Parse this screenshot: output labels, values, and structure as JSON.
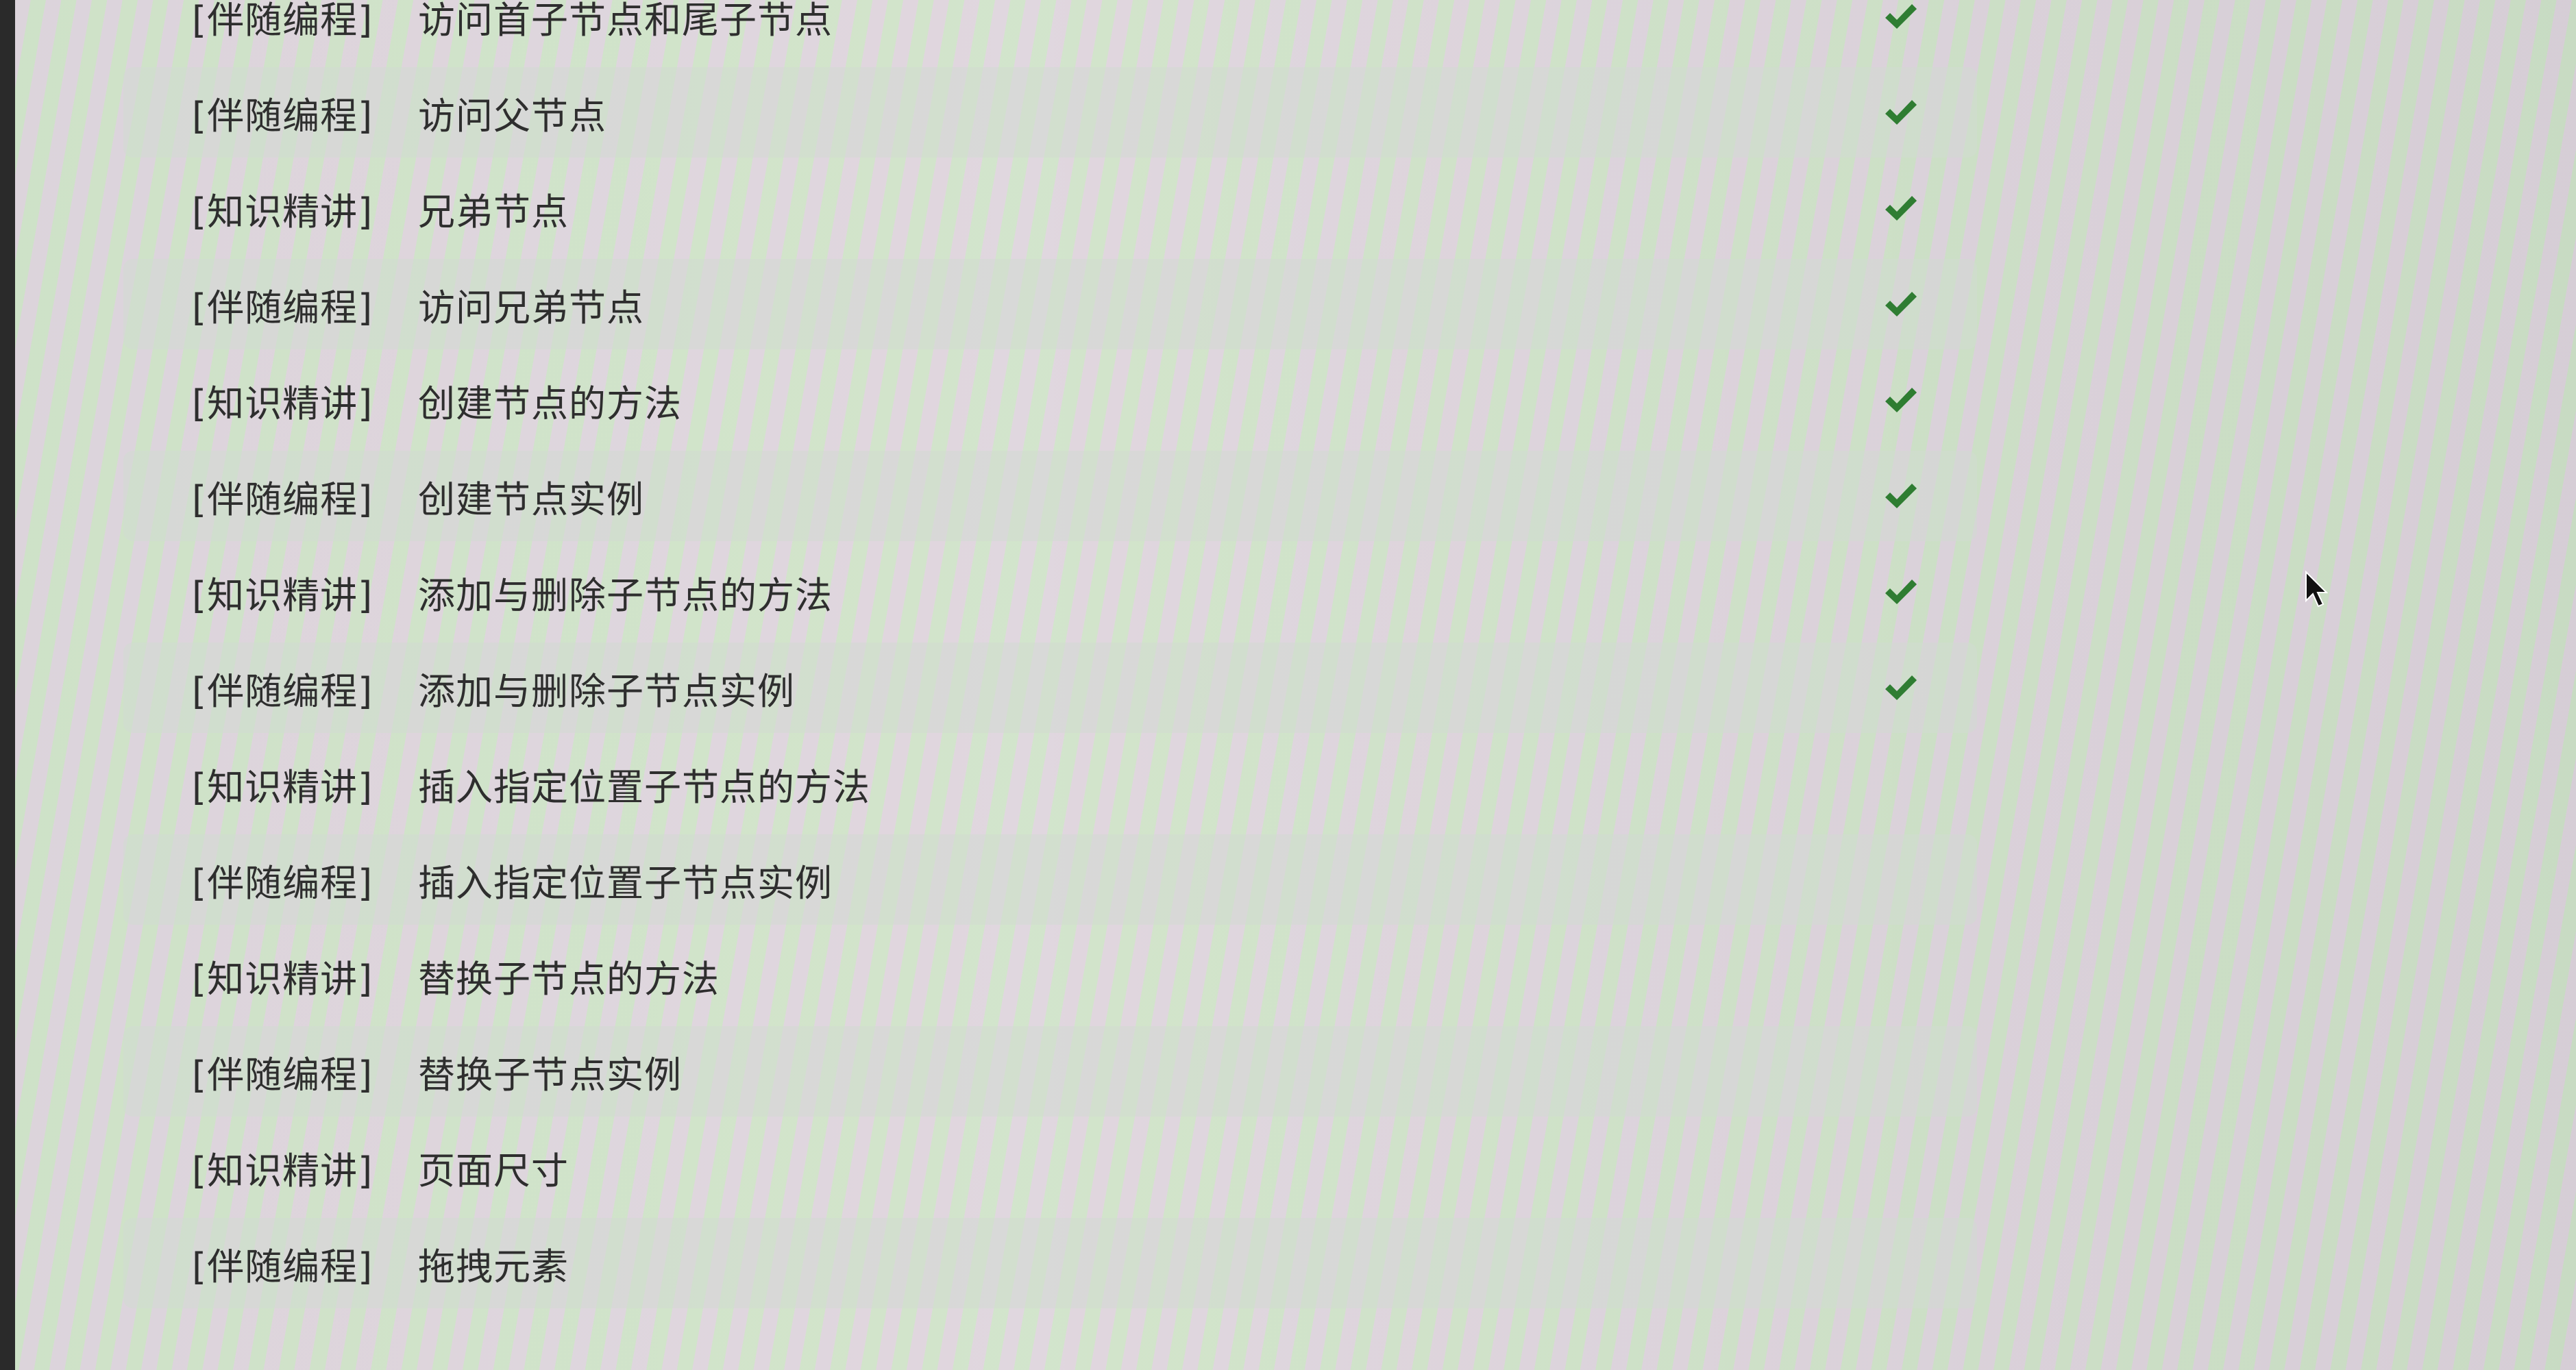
{
  "course": {
    "lessons": [
      {
        "tag": "[伴随编程]",
        "title": "访问首子节点和尾子节点",
        "completed": true
      },
      {
        "tag": "[伴随编程]",
        "title": "访问父节点",
        "completed": true
      },
      {
        "tag": "[知识精讲]",
        "title": "兄弟节点",
        "completed": true
      },
      {
        "tag": "[伴随编程]",
        "title": "访问兄弟节点",
        "completed": true
      },
      {
        "tag": "[知识精讲]",
        "title": "创建节点的方法",
        "completed": true
      },
      {
        "tag": "[伴随编程]",
        "title": "创建节点实例",
        "completed": true
      },
      {
        "tag": "[知识精讲]",
        "title": "添加与删除子节点的方法",
        "completed": true
      },
      {
        "tag": "[伴随编程]",
        "title": "添加与删除子节点实例",
        "completed": true
      },
      {
        "tag": "[知识精讲]",
        "title": "插入指定位置子节点的方法",
        "completed": false
      },
      {
        "tag": "[伴随编程]",
        "title": "插入指定位置子节点实例",
        "completed": false
      },
      {
        "tag": "[知识精讲]",
        "title": "替换子节点的方法",
        "completed": false
      },
      {
        "tag": "[伴随编程]",
        "title": "替换子节点实例",
        "completed": false
      },
      {
        "tag": "[知识精讲]",
        "title": "页面尺寸",
        "completed": false
      },
      {
        "tag": "[伴随编程]",
        "title": "拖拽元素",
        "completed": false
      }
    ]
  },
  "colors": {
    "check": "#2f7d32",
    "text": "#2e2e2e"
  },
  "icons": {
    "completed": "check-icon",
    "pointer": "mouse-cursor-icon"
  }
}
